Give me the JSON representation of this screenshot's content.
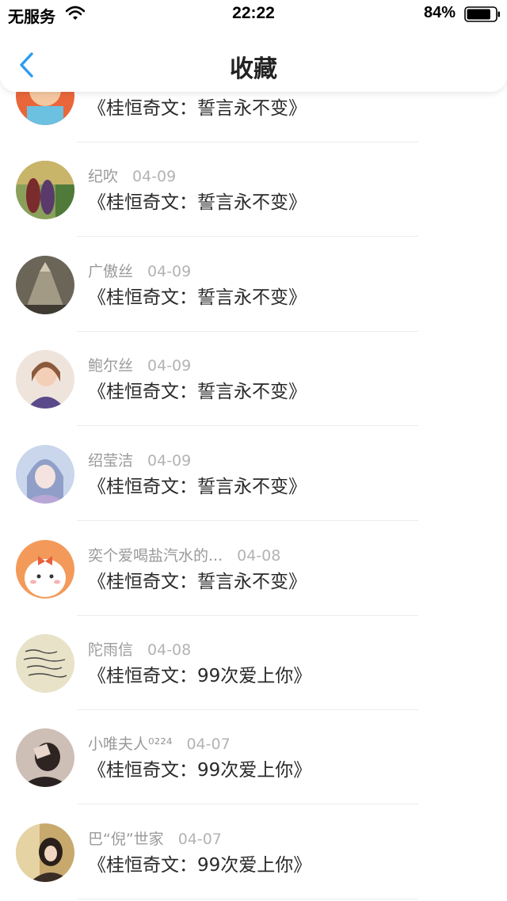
{
  "status_bar": {
    "carrier": "无服务",
    "time": "22:22",
    "battery": "84%",
    "battery_level": 0.84
  },
  "nav": {
    "title": "收藏",
    "back_icon": "chevron-left-icon",
    "accent": "#2c9cf0"
  },
  "items": [
    {
      "name": "",
      "date": "",
      "book": "《桂恒奇文：誓言永不变》"
    },
    {
      "name": "纪吹",
      "date": "04-09",
      "book": "《桂恒奇文：誓言永不变》"
    },
    {
      "name": "广傲丝",
      "date": "04-09",
      "book": "《桂恒奇文：誓言永不变》"
    },
    {
      "name": "鲍尔丝",
      "date": "04-09",
      "book": "《桂恒奇文：誓言永不变》"
    },
    {
      "name": "绍莹洁",
      "date": "04-09",
      "book": "《桂恒奇文：誓言永不变》"
    },
    {
      "name": "奕个爱喝盐汽水的...",
      "date": "04-08",
      "book": "《桂恒奇文：誓言永不变》"
    },
    {
      "name": "陀雨信",
      "date": "04-08",
      "book": "《桂恒奇文：99次爱上你》"
    },
    {
      "name": "小唯夫人⁰²²⁴",
      "date": "04-07",
      "book": "《桂恒奇文：99次爱上你》"
    },
    {
      "name": "巴“倪”世家",
      "date": "04-07",
      "book": "《桂恒奇文：99次爱上你》"
    }
  ]
}
